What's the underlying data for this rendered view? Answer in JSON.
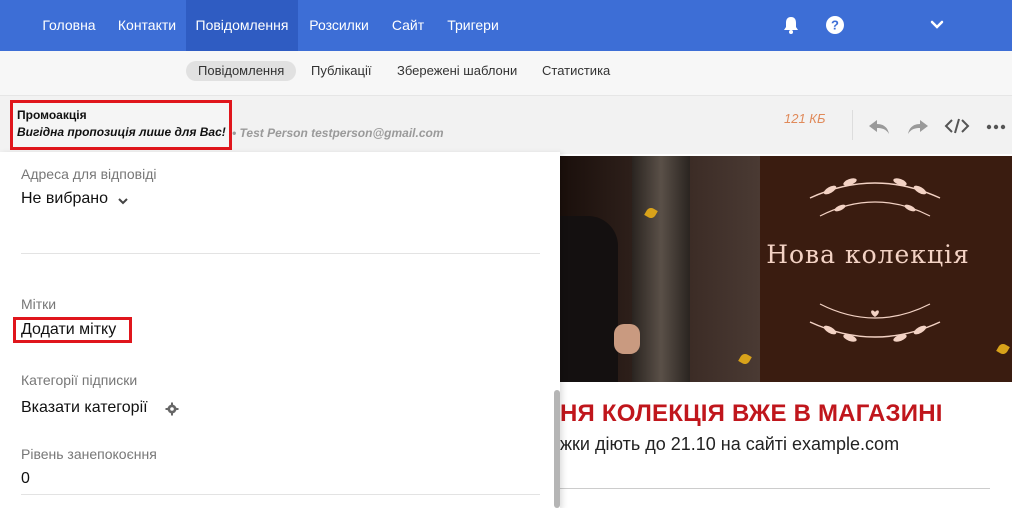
{
  "topnav": {
    "items": [
      {
        "label": "Головна"
      },
      {
        "label": "Контакти"
      },
      {
        "label": "Повідомлення",
        "active": true
      },
      {
        "label": "Розсилки"
      },
      {
        "label": "Сайт"
      },
      {
        "label": "Тригери"
      }
    ],
    "icons": [
      "bell-icon",
      "help-icon",
      "chevron-down-icon"
    ],
    "bg_color": "#3d6ed6"
  },
  "subnav": {
    "items": [
      {
        "label": "Повідомлення",
        "active": true
      },
      {
        "label": "Публікації"
      },
      {
        "label": "Збережені шаблони"
      },
      {
        "label": "Статистика"
      }
    ]
  },
  "message": {
    "title": "Промоакція",
    "subject": "Вигідна пропозиція лише для Вас!",
    "sender": "• Test Person testperson@gmail.com",
    "size": "121 КБ",
    "actions": [
      "reply-icon",
      "forward-icon",
      "code-icon",
      "more-icon"
    ]
  },
  "settings": {
    "reply_address_label": "Адреса для відповіді",
    "reply_address_value": "Не вибрано",
    "tags_label": "Мітки",
    "tags_value": "Додати мітку",
    "categories_label": "Категорії підписки",
    "categories_value": "Вказати категорії",
    "concern_label": "Рівень занепокоєння",
    "concern_value": "0"
  },
  "preview": {
    "collection_title": "Нова колекція",
    "headline": "НЯ КОЛЕКЦІЯ ВЖЕ В МАГАЗИНІ",
    "subline": "жки діють до 21.10 на сайті example.com"
  },
  "colors": {
    "highlight_border": "#e0161c",
    "headline_red": "#c0161c",
    "size_orange": "#e08a5a"
  }
}
